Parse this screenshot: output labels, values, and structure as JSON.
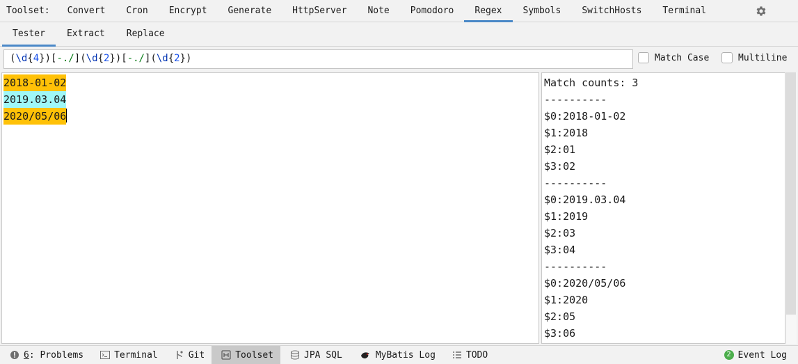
{
  "toolbar": {
    "title": "Toolset:",
    "tabs": [
      {
        "label": "Convert"
      },
      {
        "label": "Cron"
      },
      {
        "label": "Encrypt"
      },
      {
        "label": "Generate"
      },
      {
        "label": "HttpServer"
      },
      {
        "label": "Note"
      },
      {
        "label": "Pomodoro"
      },
      {
        "label": "Regex"
      },
      {
        "label": "Symbols"
      },
      {
        "label": "SwitchHosts"
      },
      {
        "label": "Terminal"
      }
    ],
    "active_tab": "Regex",
    "settings_icon": "gear-icon"
  },
  "subtabs": {
    "items": [
      {
        "label": "Tester"
      },
      {
        "label": "Extract"
      },
      {
        "label": "Replace"
      }
    ],
    "active": "Tester"
  },
  "regex": {
    "pattern": "(\\d{4})[-./](\\d{2})[-./](\\d{2})",
    "tokens": [
      {
        "t": "(",
        "k": "p"
      },
      {
        "t": "\\d",
        "k": "e"
      },
      {
        "t": "{",
        "k": "p"
      },
      {
        "t": "4",
        "k": "q"
      },
      {
        "t": "}",
        "k": "p"
      },
      {
        "t": ")",
        "k": "p"
      },
      {
        "t": "[",
        "k": "p"
      },
      {
        "t": "-./",
        "k": "c"
      },
      {
        "t": "]",
        "k": "p"
      },
      {
        "t": "(",
        "k": "p"
      },
      {
        "t": "\\d",
        "k": "e"
      },
      {
        "t": "{",
        "k": "p"
      },
      {
        "t": "2",
        "k": "q"
      },
      {
        "t": "}",
        "k": "p"
      },
      {
        "t": ")",
        "k": "p"
      },
      {
        "t": "[",
        "k": "p"
      },
      {
        "t": "-./",
        "k": "c"
      },
      {
        "t": "]",
        "k": "p"
      },
      {
        "t": "(",
        "k": "p"
      },
      {
        "t": "\\d",
        "k": "e"
      },
      {
        "t": "{",
        "k": "p"
      },
      {
        "t": "2",
        "k": "q"
      },
      {
        "t": "}",
        "k": "p"
      },
      {
        "t": ")",
        "k": "p"
      }
    ]
  },
  "options": {
    "match_case": {
      "label": "Match Case",
      "checked": false
    },
    "multiline": {
      "label": "Multiline",
      "checked": false
    }
  },
  "input_lines": [
    {
      "text": "2018-01-02",
      "highlight": "#ffc107"
    },
    {
      "text": "2019.03.04",
      "highlight": "#9ff7f7"
    },
    {
      "text": "2020/05/06",
      "highlight": "#ffc107"
    }
  ],
  "results": [
    "Match counts: 3",
    "----------",
    "$0:2018-01-02",
    "$1:2018",
    "$2:01",
    "$3:02",
    "----------",
    "$0:2019.03.04",
    "$1:2019",
    "$2:03",
    "$3:04",
    "----------",
    "$0:2020/05/06",
    "$1:2020",
    "$2:05",
    "$3:06"
  ],
  "statusbar": {
    "problems": {
      "prefix": "6",
      "label": ": Problems",
      "icon": "problems-icon"
    },
    "terminal": {
      "label": "Terminal",
      "icon": "terminal-icon"
    },
    "git": {
      "label": "Git",
      "icon": "git-icon"
    },
    "toolset": {
      "label": "Toolset",
      "icon": "toolset-icon"
    },
    "jpa": {
      "label": "JPA SQL",
      "icon": "database-icon"
    },
    "mybatis": {
      "label": "MyBatis Log",
      "icon": "mybatis-bird-icon"
    },
    "todo": {
      "label": "TODO",
      "icon": "list-icon"
    },
    "event_log": {
      "count": "2",
      "label": "Event Log"
    }
  }
}
